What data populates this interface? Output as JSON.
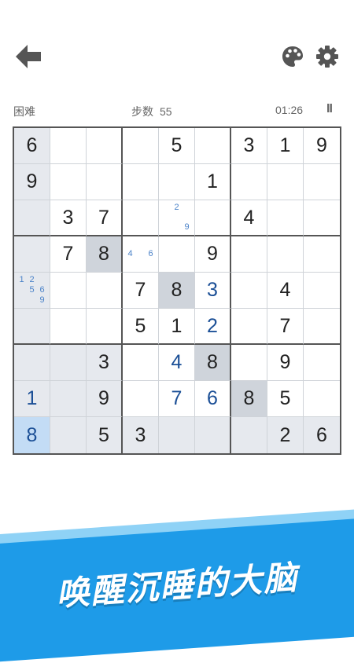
{
  "header": {
    "back_icon": "arrow-left-icon",
    "palette_icon": "palette-icon",
    "settings_icon": "gear-icon"
  },
  "status": {
    "difficulty": "困难",
    "steps_label": "步数",
    "steps_value": "55",
    "timer": "01:26",
    "pause_label": "II"
  },
  "board": {
    "rows": [
      [
        "6",
        "",
        "",
        "",
        "5",
        "",
        "3",
        "1",
        "9"
      ],
      [
        "9",
        "",
        "",
        "",
        "",
        "1",
        "",
        "",
        ""
      ],
      [
        "",
        "3",
        "7",
        "",
        "",
        "",
        "4",
        "",
        ""
      ],
      [
        "",
        "7",
        "8",
        "",
        "",
        "9",
        "",
        "",
        ""
      ],
      [
        "",
        "",
        "",
        "7",
        "8",
        "3",
        "",
        "4",
        ""
      ],
      [
        "",
        "",
        "",
        "5",
        "1",
        "2",
        "",
        "7",
        ""
      ],
      [
        "",
        "",
        "3",
        "",
        "4",
        "8",
        "",
        "9",
        ""
      ],
      [
        "1",
        "",
        "9",
        "",
        "7",
        "6",
        "8",
        "5",
        ""
      ],
      [
        "8",
        "",
        "5",
        "3",
        "",
        "",
        "",
        "2",
        "6"
      ]
    ],
    "user_cells": [
      [
        4,
        5
      ],
      [
        5,
        5
      ],
      [
        6,
        4
      ],
      [
        7,
        0
      ],
      [
        7,
        4
      ],
      [
        7,
        5
      ],
      [
        8,
        0
      ]
    ],
    "notes": [
      {
        "row": 2,
        "col": 4,
        "digits": [
          2,
          9
        ]
      },
      {
        "row": 3,
        "col": 3,
        "digits": [
          4,
          6
        ]
      },
      {
        "row": 4,
        "col": 0,
        "digits": [
          1,
          2,
          5,
          6,
          9
        ]
      }
    ],
    "selected": [
      8,
      0
    ],
    "accent_color": "#1b4f96"
  },
  "banner": {
    "slogan": "唤醒沉睡的大脑",
    "color": "#1e9be8"
  }
}
